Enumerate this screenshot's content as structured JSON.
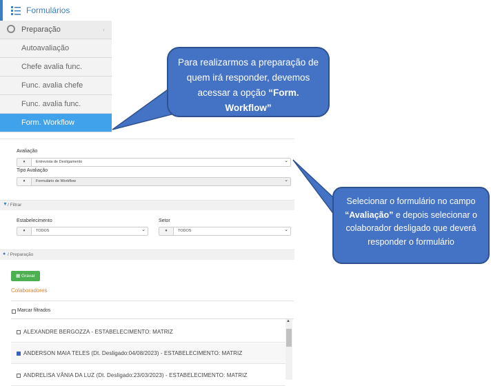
{
  "nav": {
    "title": "Formulários",
    "menu": [
      {
        "label": "Preparação",
        "icon": "podcast-icon",
        "header": true
      },
      {
        "label": "Autoavaliação"
      },
      {
        "label": "Chefe avalia func."
      },
      {
        "label": "Func. avalia chefe"
      },
      {
        "label": "Func. avalia func."
      },
      {
        "label": "Form. Workflow",
        "selected": true
      }
    ]
  },
  "callouts": {
    "first": {
      "text_before": "Para realizarmos a preparação de quem irá responder, devemos acessar a opção ",
      "bold": "“Form. Workflow”"
    },
    "second": {
      "text_before": "Selecionar o formulário no campo ",
      "bold": "“Avaliação”",
      "text_after": " e depois selecionar o colaborador desligado que deverá responder o formulário"
    }
  },
  "form": {
    "avaliacao": {
      "label": "Avaliação",
      "value": "Entrevista de Desligamento"
    },
    "tipo_avaliacao": {
      "label": "Tipo Avaliação",
      "value": "Formulário de Workflow"
    },
    "filtrar": {
      "title": "Filtrar"
    },
    "estabelecimento": {
      "label": "Estabelecimento",
      "value": "TODOS"
    },
    "setor": {
      "label": "Setor",
      "value": "TODOS"
    },
    "preparacao": {
      "title": "Preparação"
    },
    "gravar_label": "Gravar",
    "colaboradores_title": "Colaboradores",
    "marcar_filtrados": "Marcar filtrados",
    "collaborators": [
      {
        "text": "ALEXANDRE BERGOZZA - ESTABELECIMENTO: MATRIZ",
        "checked": false
      },
      {
        "text": "ANDERSON MAIA TELES (Dt. Desligado:04/08/2023) - ESTABELECIMENTO: MATRIZ",
        "checked": true
      },
      {
        "text": "ANDRELISA VÂNIA DA LUZ (Dt. Desligado:23/03/2023) - ESTABELECIMENTO: MATRIZ",
        "checked": false
      }
    ]
  },
  "colors": {
    "accent": "#3a7fc1",
    "selected": "#3fa2ea",
    "callout": "#4472c4",
    "gravar": "#4caf50",
    "colab": "#e0842f"
  }
}
